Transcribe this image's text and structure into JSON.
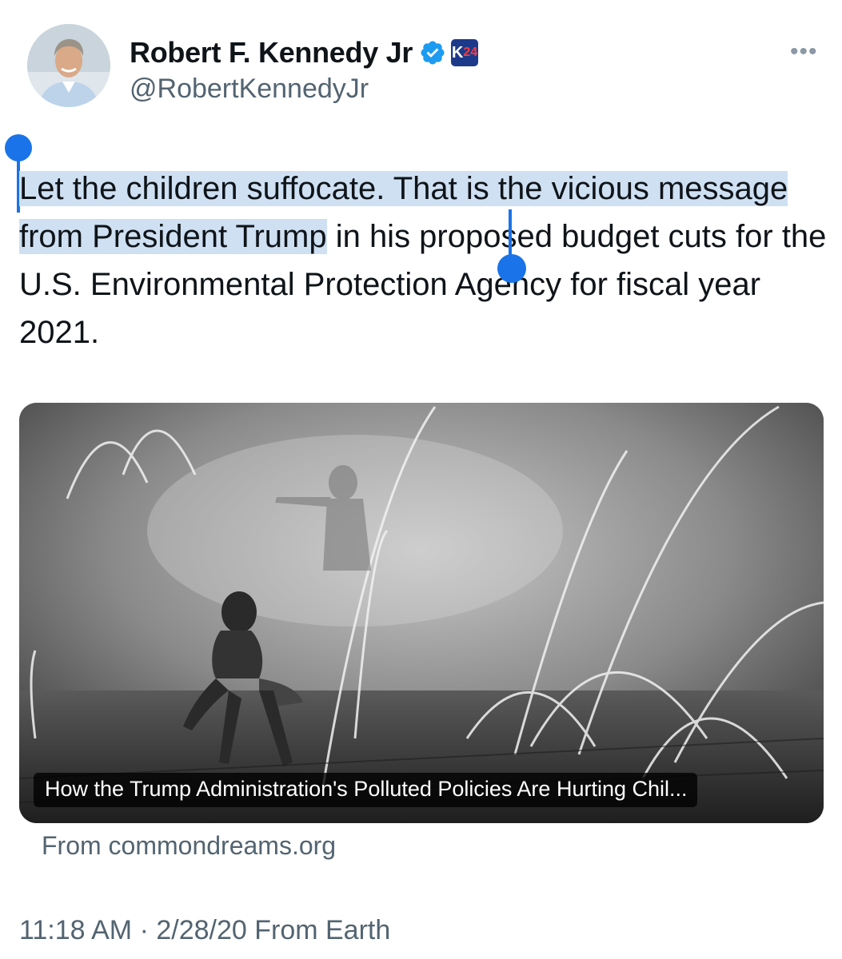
{
  "author": {
    "display_name": "Robert F. Kennedy Jr",
    "handle": "@RobertKennedyJr",
    "badge_text": "K",
    "badge_text_accent": "24"
  },
  "tweet": {
    "text_selected": "Let the children suffocate. That is the vicious message from President Trump",
    "text_rest": " in his proposed budget cuts for the U.S. Environmental Protection Agency for fiscal year 2021."
  },
  "card": {
    "title": "How the Trump Administration's Polluted Policies Are Hurting Chil...",
    "source": "From commondreams.org"
  },
  "meta": {
    "timestamp": "11:18 AM · 2/28/20 From Earth"
  },
  "colors": {
    "selection": "#cfe0f3",
    "selection_handle": "#1a73e8",
    "verified": "#1d9bf0",
    "secondary_text": "#536471"
  },
  "icons": {
    "more": "more-horizontal-icon",
    "verified": "verified-badge-icon",
    "affiliation": "affiliation-badge-icon"
  }
}
